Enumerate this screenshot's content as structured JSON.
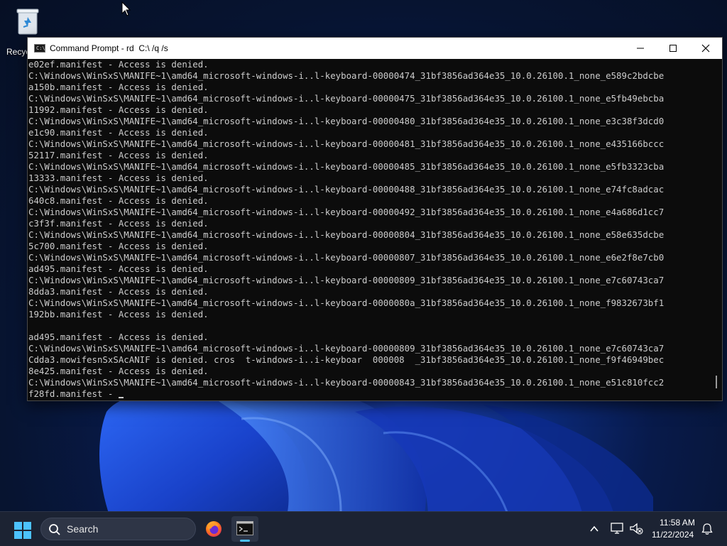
{
  "desktop": {
    "recycle_bin_label": "Recycle Bin"
  },
  "window": {
    "title": "Command Prompt - rd  C:\\ /q /s",
    "buttons": [
      "minimize",
      "maximize",
      "close"
    ]
  },
  "console": {
    "lines": [
      "e02ef.manifest - Access is denied.",
      "C:\\Windows\\WinSxS\\MANIFE~1\\amd64_microsoft-windows-i..l-keyboard-00000474_31bf3856ad364e35_10.0.26100.1_none_e589c2bdcbe",
      "a150b.manifest - Access is denied.",
      "C:\\Windows\\WinSxS\\MANIFE~1\\amd64_microsoft-windows-i..l-keyboard-00000475_31bf3856ad364e35_10.0.26100.1_none_e5fb49ebcba",
      "11992.manifest - Access is denied.",
      "C:\\Windows\\WinSxS\\MANIFE~1\\amd64_microsoft-windows-i..l-keyboard-00000480_31bf3856ad364e35_10.0.26100.1_none_e3c38f3dcd0",
      "e1c90.manifest - Access is denied.",
      "C:\\Windows\\WinSxS\\MANIFE~1\\amd64_microsoft-windows-i..l-keyboard-00000481_31bf3856ad364e35_10.0.26100.1_none_e435166bccc",
      "52117.manifest - Access is denied.",
      "C:\\Windows\\WinSxS\\MANIFE~1\\amd64_microsoft-windows-i..l-keyboard-00000485_31bf3856ad364e35_10.0.26100.1_none_e5fb3323cba",
      "13333.manifest - Access is denied.",
      "C:\\Windows\\WinSxS\\MANIFE~1\\amd64_microsoft-windows-i..l-keyboard-00000488_31bf3856ad364e35_10.0.26100.1_none_e74fc8adcac",
      "640c8.manifest - Access is denied.",
      "C:\\Windows\\WinSxS\\MANIFE~1\\amd64_microsoft-windows-i..l-keyboard-00000492_31bf3856ad364e35_10.0.26100.1_none_e4a686d1cc7",
      "c3f3f.manifest - Access is denied.",
      "C:\\Windows\\WinSxS\\MANIFE~1\\amd64_microsoft-windows-i..l-keyboard-00000804_31bf3856ad364e35_10.0.26100.1_none_e58e635dcbe",
      "5c700.manifest - Access is denied.",
      "C:\\Windows\\WinSxS\\MANIFE~1\\amd64_microsoft-windows-i..l-keyboard-00000807_31bf3856ad364e35_10.0.26100.1_none_e6e2f8e7cb0",
      "ad495.manifest - Access is denied.",
      "C:\\Windows\\WinSxS\\MANIFE~1\\amd64_microsoft-windows-i..l-keyboard-00000809_31bf3856ad364e35_10.0.26100.1_none_e7c60743ca7",
      "8dda3.manifest - Access is denied.",
      "C:\\Windows\\WinSxS\\MANIFE~1\\amd64_microsoft-windows-i..l-keyboard-0000080a_31bf3856ad364e35_10.0.26100.1_none_f9832673bf1",
      "192bb.manifest - Access is denied.",
      "",
      "ad495.manifest - Access is denied.",
      "C:\\Windows\\WinSxS\\MANIFE~1\\amd64_microsoft-windows-i..l-keyboard-00000809_31bf3856ad364e35_10.0.26100.1_none_e7c60743ca7",
      "Cdda3.mowifesnSxSAcANIF is denied. cros  t-windows-i..i-keyboar  000008  _31bf3856ad364e35_10.0.26100.1_none_f9f46949bec",
      "8e425.manifest - Access is denied.",
      "C:\\Windows\\WinSxS\\MANIFE~1\\amd64_microsoft-windows-i..l-keyboard-00000843_31bf3856ad364e35_10.0.26100.1_none_e51c810fcc2",
      "f28fd.manifest - "
    ]
  },
  "taskbar": {
    "search_label": "Search",
    "time": "11:58 AM",
    "date": "11/22/2024",
    "pinned": [
      "firefox-icon",
      "command-prompt-icon"
    ]
  },
  "colors": {
    "console_bg": "#0c0c0c",
    "console_fg": "#cccccc",
    "taskbar_bg": "#1c2333",
    "accent": "#4cc2ff"
  }
}
